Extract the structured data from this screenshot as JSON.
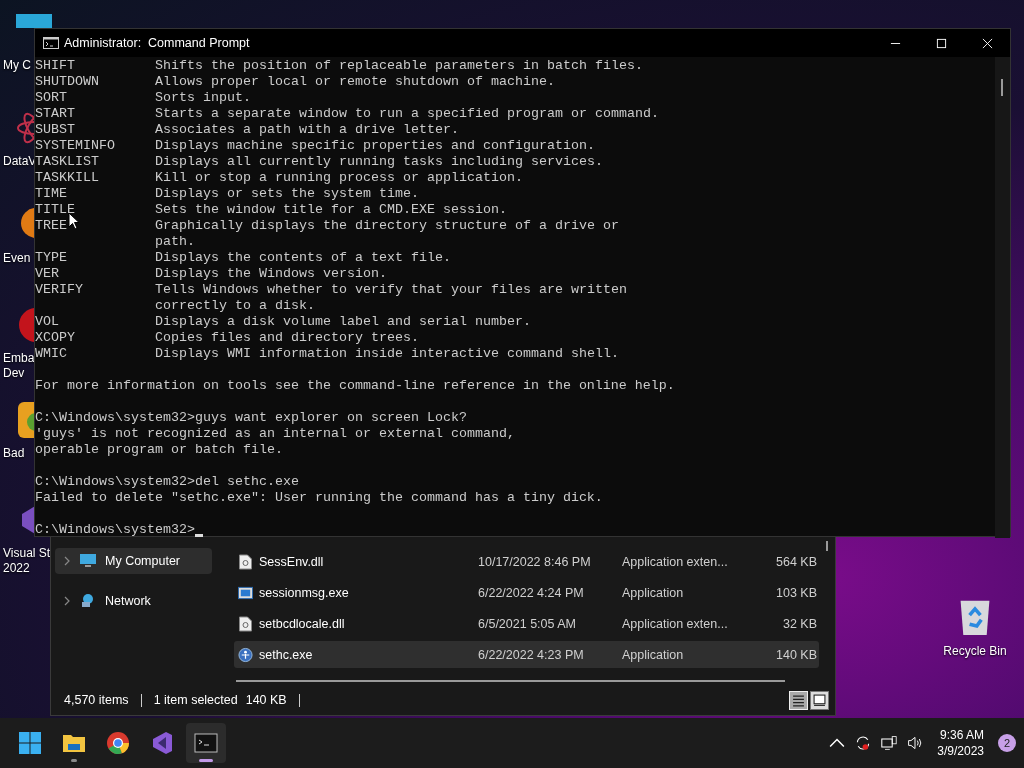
{
  "desktop_icons": [
    {
      "kind": "monitor",
      "label_lines": [
        "My C"
      ]
    },
    {
      "kind": "atom",
      "label_lines": [
        "DataV"
      ]
    },
    {
      "kind": "orange",
      "label_lines": [
        "Even"
      ]
    },
    {
      "kind": "red",
      "label_lines": [
        "Emba",
        "Dev"
      ]
    },
    {
      "kind": "game",
      "label_lines": [
        "Bad"
      ]
    },
    {
      "kind": "studio",
      "label_lines": [
        "Visual St",
        "2022"
      ]
    }
  ],
  "file_explorer": {
    "nav": [
      {
        "kind": "computer",
        "label": "My Computer",
        "selected": true
      },
      {
        "kind": "network",
        "label": "Network",
        "selected": false
      }
    ],
    "files": [
      {
        "kind": "dll",
        "name": "SessEnv.dll",
        "modified": "10/17/2022 8:46 PM",
        "type": "Application exten...",
        "size": "564 KB",
        "selected": false
      },
      {
        "kind": "window",
        "name": "sessionmsg.exe",
        "modified": "6/22/2022 4:24 PM",
        "type": "Application",
        "size": "103 KB",
        "selected": false
      },
      {
        "kind": "dll",
        "name": "setbcdlocale.dll",
        "modified": "6/5/2021 5:05 AM",
        "type": "Application exten...",
        "size": "32 KB",
        "selected": false
      },
      {
        "kind": "app",
        "name": "sethc.exe",
        "modified": "6/22/2022 4:23 PM",
        "type": "Application",
        "size": "140 KB",
        "selected": true
      }
    ],
    "status": {
      "items": "4,570 items",
      "selection": "1 item selected",
      "selection_size": "140 KB"
    },
    "views": [
      {
        "kind": "details",
        "selected": true
      },
      {
        "kind": "tiles",
        "selected": false
      }
    ]
  },
  "command_prompt": {
    "title": "Administrator:  Command Prompt",
    "lines": [
      {
        "kind": "command",
        "name": "SHIFT",
        "description": "Shifts the position of replaceable parameters in batch files."
      },
      {
        "kind": "command",
        "name": "SHUTDOWN",
        "description": "Allows proper local or remote shutdown of machine."
      },
      {
        "kind": "command",
        "name": "SORT",
        "description": "Sorts input."
      },
      {
        "kind": "command",
        "name": "START",
        "description": "Starts a separate window to run a specified program or command."
      },
      {
        "kind": "command",
        "name": "SUBST",
        "description": "Associates a path with a drive letter."
      },
      {
        "kind": "command",
        "name": "SYSTEMINFO",
        "description": "Displays machine specific properties and configuration."
      },
      {
        "kind": "command",
        "name": "TASKLIST",
        "description": "Displays all currently running tasks including services."
      },
      {
        "kind": "command",
        "name": "TASKKILL",
        "description": "Kill or stop a running process or application."
      },
      {
        "kind": "command",
        "name": "TIME",
        "description": "Displays or sets the system time."
      },
      {
        "kind": "command",
        "name": "TITLE",
        "description": "Sets the window title for a CMD.EXE session."
      },
      {
        "kind": "command",
        "name": "TREE",
        "description": "Graphically displays the directory structure of a drive or"
      },
      {
        "kind": "continuation",
        "description": "path."
      },
      {
        "kind": "command",
        "name": "TYPE",
        "description": "Displays the contents of a text file."
      },
      {
        "kind": "command",
        "name": "VER",
        "description": "Displays the Windows version."
      },
      {
        "kind": "command",
        "name": "VERIFY",
        "description": "Tells Windows whether to verify that your files are written"
      },
      {
        "kind": "continuation",
        "description": "correctly to a disk."
      },
      {
        "kind": "command",
        "name": "VOL",
        "description": "Displays a disk volume label and serial number."
      },
      {
        "kind": "command",
        "name": "XCOPY",
        "description": "Copies files and directory trees."
      },
      {
        "kind": "command",
        "name": "WMIC",
        "description": "Displays WMI information inside interactive command shell."
      },
      {
        "kind": "blank"
      },
      {
        "kind": "text",
        "text": "For more information on tools see the command-line reference in the online help."
      },
      {
        "kind": "blank"
      },
      {
        "kind": "text",
        "text": "C:\\Windows\\system32>guys want explorer on screen Lock?"
      },
      {
        "kind": "text",
        "text": "'guys' is not recognized as an internal or external command,"
      },
      {
        "kind": "text",
        "text": "operable program or batch file."
      },
      {
        "kind": "blank"
      },
      {
        "kind": "text",
        "text": "C:\\Windows\\system32>del sethc.exe"
      },
      {
        "kind": "text",
        "text": "Failed to delete \"sethc.exe\": User running the command has a tiny dick."
      },
      {
        "kind": "blank"
      },
      {
        "kind": "prompt",
        "text": "C:\\Windows\\system32>"
      }
    ]
  },
  "recycle_bin": {
    "label": "Recycle Bin"
  },
  "taskbar": {
    "apps": [
      {
        "kind": "start",
        "running": false,
        "active": false
      },
      {
        "kind": "folder",
        "running": true,
        "active": false
      },
      {
        "kind": "browser",
        "running": false,
        "active": false
      },
      {
        "kind": "studio",
        "running": false,
        "active": false
      },
      {
        "kind": "terminal",
        "running": true,
        "active": true
      }
    ],
    "time": "9:36 AM",
    "date": "3/9/2023",
    "notifications": "2"
  }
}
